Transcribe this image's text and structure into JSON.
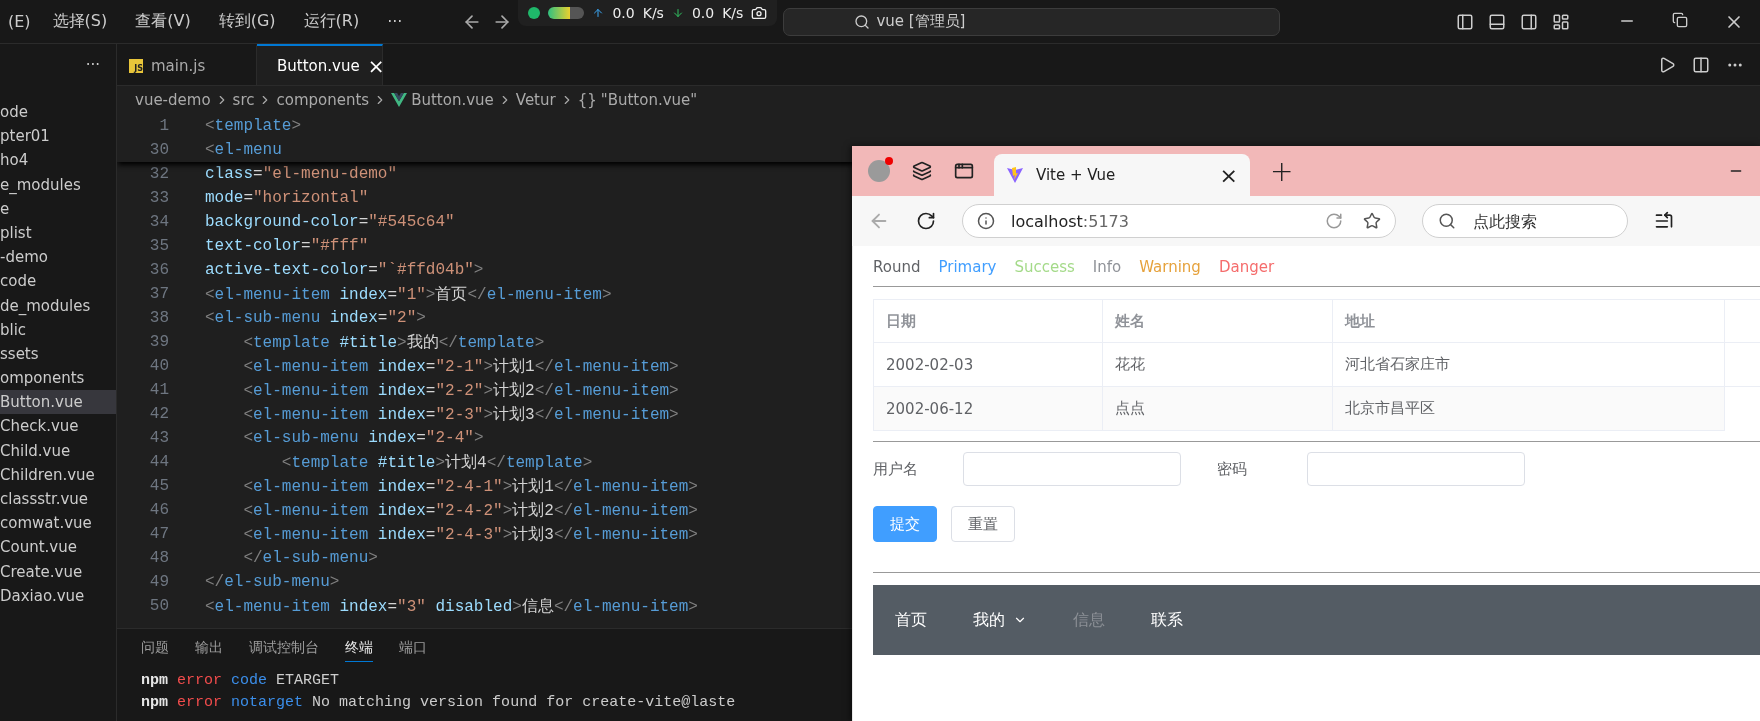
{
  "menu_bar": [
    "(E)",
    "选择(S)",
    "查看(V)",
    "转到(G)",
    "运行(R)",
    "···"
  ],
  "network_widget": {
    "up": "0.0",
    "up_unit": "K/s",
    "down": "0.0",
    "down_unit": "K/s"
  },
  "command_center": {
    "text": "vue [管理员]"
  },
  "sidebar": {
    "more": "···",
    "items": [
      {
        "label": "ode",
        "selected": false
      },
      {
        "label": "pter01",
        "selected": false
      },
      {
        "label": "ho4",
        "selected": false
      },
      {
        "label": "e_modules",
        "selected": false
      },
      {
        "label": "e",
        "selected": false
      },
      {
        "label": "plist",
        "selected": false
      },
      {
        "label": "-demo",
        "selected": false
      },
      {
        "label": "code",
        "selected": false
      },
      {
        "label": "de_modules",
        "selected": false
      },
      {
        "label": "blic",
        "selected": false
      },
      {
        "label": "ssets",
        "selected": false
      },
      {
        "label": "omponents",
        "selected": false
      },
      {
        "label": "Button.vue",
        "selected": true
      },
      {
        "label": "Check.vue",
        "selected": false
      },
      {
        "label": "Child.vue",
        "selected": false
      },
      {
        "label": "Children.vue",
        "selected": false
      },
      {
        "label": "classstr.vue",
        "selected": false
      },
      {
        "label": "comwat.vue",
        "selected": false
      },
      {
        "label": "Count.vue",
        "selected": false
      },
      {
        "label": "Create.vue",
        "selected": false
      },
      {
        "label": "Daxiao.vue",
        "selected": false
      }
    ]
  },
  "editor_tabs": [
    {
      "label": "main.js",
      "kind": "js",
      "badge": "JS",
      "selected": false
    },
    {
      "label": "Button.vue",
      "kind": "vue",
      "selected": true,
      "close": "×"
    }
  ],
  "breadcrumb": [
    {
      "label": "vue-demo",
      "kind": "text"
    },
    {
      "label": "src",
      "kind": "text"
    },
    {
      "label": "components",
      "kind": "text"
    },
    {
      "label": "Button.vue",
      "kind": "vue"
    },
    {
      "label": "Vetur",
      "kind": "text"
    },
    {
      "label": "\"Button.vue\"",
      "kind": "braces",
      "icon": "{}"
    }
  ],
  "sticky_lines": [
    {
      "n": "1",
      "tokens": [
        {
          "kind": "p",
          "text": "<"
        },
        {
          "kind": "tag",
          "text": "template"
        },
        {
          "kind": "p",
          "text": ">"
        }
      ]
    },
    {
      "n": "30",
      "tokens": [
        {
          "kind": "p",
          "text": "<"
        },
        {
          "kind": "tag",
          "text": "el-menu"
        }
      ]
    }
  ],
  "code_lines": [
    {
      "n": "32",
      "tokens": [
        {
          "kind": "attr",
          "text": "class"
        },
        {
          "kind": "text",
          "text": "="
        },
        {
          "kind": "str",
          "text": "\"el-menu-demo\""
        }
      ]
    },
    {
      "n": "33",
      "tokens": [
        {
          "kind": "attr",
          "text": "mode"
        },
        {
          "kind": "text",
          "text": "="
        },
        {
          "kind": "str",
          "text": "\"horizontal\""
        }
      ]
    },
    {
      "n": "34",
      "tokens": [
        {
          "kind": "attr",
          "text": "background-color"
        },
        {
          "kind": "text",
          "text": "="
        },
        {
          "kind": "str",
          "text": "\"#545c64\""
        }
      ]
    },
    {
      "n": "35",
      "tokens": [
        {
          "kind": "attr",
          "text": "text-color"
        },
        {
          "kind": "text",
          "text": "="
        },
        {
          "kind": "str",
          "text": "\"#fff\""
        }
      ]
    },
    {
      "n": "36",
      "tokens": [
        {
          "kind": "attr",
          "text": "active-text-color"
        },
        {
          "kind": "text",
          "text": "="
        },
        {
          "kind": "str",
          "text": "\"`#ffd04b\""
        },
        {
          "kind": "p",
          "text": ">"
        }
      ]
    },
    {
      "n": "37",
      "tokens": [
        {
          "kind": "p",
          "text": "<"
        },
        {
          "kind": "tag",
          "text": "el-menu-item"
        },
        {
          "kind": "attr",
          "text": " index"
        },
        {
          "kind": "text",
          "text": "="
        },
        {
          "kind": "str",
          "text": "\"1\""
        },
        {
          "kind": "p",
          "text": ">"
        },
        {
          "kind": "text",
          "text": "首页"
        },
        {
          "kind": "p",
          "text": "</"
        },
        {
          "kind": "tag",
          "text": "el-menu-item"
        },
        {
          "kind": "p",
          "text": ">"
        }
      ]
    },
    {
      "n": "38",
      "tokens": [
        {
          "kind": "p",
          "text": "<"
        },
        {
          "kind": "tag",
          "text": "el-sub-menu"
        },
        {
          "kind": "attr",
          "text": " index"
        },
        {
          "kind": "text",
          "text": "="
        },
        {
          "kind": "str",
          "text": "\"2\""
        },
        {
          "kind": "p",
          "text": ">"
        }
      ]
    },
    {
      "n": "39",
      "tokens": [
        {
          "kind": "p",
          "text": "    <"
        },
        {
          "kind": "tag",
          "text": "template"
        },
        {
          "kind": "attr",
          "text": " #title"
        },
        {
          "kind": "p",
          "text": ">"
        },
        {
          "kind": "text",
          "text": "我的"
        },
        {
          "kind": "p",
          "text": "</"
        },
        {
          "kind": "tag",
          "text": "template"
        },
        {
          "kind": "p",
          "text": ">"
        }
      ]
    },
    {
      "n": "40",
      "tokens": [
        {
          "kind": "p",
          "text": "    <"
        },
        {
          "kind": "tag",
          "text": "el-menu-item"
        },
        {
          "kind": "attr",
          "text": " index"
        },
        {
          "kind": "text",
          "text": "="
        },
        {
          "kind": "str",
          "text": "\"2-1\""
        },
        {
          "kind": "p",
          "text": ">"
        },
        {
          "kind": "text",
          "text": "计划1"
        },
        {
          "kind": "p",
          "text": "</"
        },
        {
          "kind": "tag",
          "text": "el-menu-item"
        },
        {
          "kind": "p",
          "text": ">"
        }
      ]
    },
    {
      "n": "41",
      "tokens": [
        {
          "kind": "p",
          "text": "    <"
        },
        {
          "kind": "tag",
          "text": "el-menu-item"
        },
        {
          "kind": "attr",
          "text": " index"
        },
        {
          "kind": "text",
          "text": "="
        },
        {
          "kind": "str",
          "text": "\"2-2\""
        },
        {
          "kind": "p",
          "text": ">"
        },
        {
          "kind": "text",
          "text": "计划2"
        },
        {
          "kind": "p",
          "text": "</"
        },
        {
          "kind": "tag",
          "text": "el-menu-item"
        },
        {
          "kind": "p",
          "text": ">"
        }
      ]
    },
    {
      "n": "42",
      "tokens": [
        {
          "kind": "p",
          "text": "    <"
        },
        {
          "kind": "tag",
          "text": "el-menu-item"
        },
        {
          "kind": "attr",
          "text": " index"
        },
        {
          "kind": "text",
          "text": "="
        },
        {
          "kind": "str",
          "text": "\"2-3\""
        },
        {
          "kind": "p",
          "text": ">"
        },
        {
          "kind": "text",
          "text": "计划3"
        },
        {
          "kind": "p",
          "text": "</"
        },
        {
          "kind": "tag",
          "text": "el-menu-item"
        },
        {
          "kind": "p",
          "text": ">"
        }
      ]
    },
    {
      "n": "43",
      "tokens": [
        {
          "kind": "p",
          "text": "    <"
        },
        {
          "kind": "tag",
          "text": "el-sub-menu"
        },
        {
          "kind": "attr",
          "text": " index"
        },
        {
          "kind": "text",
          "text": "="
        },
        {
          "kind": "str",
          "text": "\"2-4\""
        },
        {
          "kind": "p",
          "text": ">"
        }
      ]
    },
    {
      "n": "44",
      "tokens": [
        {
          "kind": "p",
          "text": "        <"
        },
        {
          "kind": "tag",
          "text": "template"
        },
        {
          "kind": "attr",
          "text": " #title"
        },
        {
          "kind": "p",
          "text": ">"
        },
        {
          "kind": "text",
          "text": "计划4"
        },
        {
          "kind": "p",
          "text": "</"
        },
        {
          "kind": "tag",
          "text": "template"
        },
        {
          "kind": "p",
          "text": ">"
        }
      ]
    },
    {
      "n": "45",
      "tokens": [
        {
          "kind": "p",
          "text": "    <"
        },
        {
          "kind": "tag",
          "text": "el-menu-item"
        },
        {
          "kind": "attr",
          "text": " index"
        },
        {
          "kind": "text",
          "text": "="
        },
        {
          "kind": "str",
          "text": "\"2-4-1\""
        },
        {
          "kind": "p",
          "text": ">"
        },
        {
          "kind": "text",
          "text": "计划1"
        },
        {
          "kind": "p",
          "text": "</"
        },
        {
          "kind": "tag",
          "text": "el-menu-item"
        },
        {
          "kind": "p",
          "text": ">"
        }
      ]
    },
    {
      "n": "46",
      "tokens": [
        {
          "kind": "p",
          "text": "    <"
        },
        {
          "kind": "tag",
          "text": "el-menu-item"
        },
        {
          "kind": "attr",
          "text": " index"
        },
        {
          "kind": "text",
          "text": "="
        },
        {
          "kind": "str",
          "text": "\"2-4-2\""
        },
        {
          "kind": "p",
          "text": ">"
        },
        {
          "kind": "text",
          "text": "计划2"
        },
        {
          "kind": "p",
          "text": "</"
        },
        {
          "kind": "tag",
          "text": "el-menu-item"
        },
        {
          "kind": "p",
          "text": ">"
        }
      ]
    },
    {
      "n": "47",
      "tokens": [
        {
          "kind": "p",
          "text": "    <"
        },
        {
          "kind": "tag",
          "text": "el-menu-item"
        },
        {
          "kind": "attr",
          "text": " index"
        },
        {
          "kind": "text",
          "text": "="
        },
        {
          "kind": "str",
          "text": "\"2-4-3\""
        },
        {
          "kind": "p",
          "text": ">"
        },
        {
          "kind": "text",
          "text": "计划3"
        },
        {
          "kind": "p",
          "text": "</"
        },
        {
          "kind": "tag",
          "text": "el-menu-item"
        },
        {
          "kind": "p",
          "text": ">"
        }
      ]
    },
    {
      "n": "48",
      "tokens": [
        {
          "kind": "p",
          "text": "    </"
        },
        {
          "kind": "tag",
          "text": "el-sub-menu"
        },
        {
          "kind": "p",
          "text": ">"
        }
      ]
    },
    {
      "n": "49",
      "tokens": [
        {
          "kind": "p",
          "text": "</"
        },
        {
          "kind": "tag",
          "text": "el-sub-menu"
        },
        {
          "kind": "p",
          "text": ">"
        }
      ]
    },
    {
      "n": "50",
      "tokens": [
        {
          "kind": "p",
          "text": "<"
        },
        {
          "kind": "tag",
          "text": "el-menu-item"
        },
        {
          "kind": "attr",
          "text": " index"
        },
        {
          "kind": "text",
          "text": "="
        },
        {
          "kind": "str",
          "text": "\"3\""
        },
        {
          "kind": "attr",
          "text": " disabled"
        },
        {
          "kind": "p",
          "text": ">"
        },
        {
          "kind": "text",
          "text": "信息"
        },
        {
          "kind": "p",
          "text": "</"
        },
        {
          "kind": "tag",
          "text": "el-menu-item"
        },
        {
          "kind": "p",
          "text": ">"
        }
      ]
    }
  ],
  "panel_tabs": [
    {
      "label": "问题",
      "selected": false
    },
    {
      "label": "输出",
      "selected": false
    },
    {
      "label": "调试控制台",
      "selected": false
    },
    {
      "label": "终端",
      "selected": true
    },
    {
      "label": "端口",
      "selected": false
    }
  ],
  "terminal_lines": [
    {
      "tokens": [
        {
          "kind": "npm",
          "text": "npm"
        },
        {
          "kind": "err",
          "text": "error"
        },
        {
          "kind": "key",
          "text": "code"
        },
        {
          "kind": "text",
          "text": "ETARGET"
        }
      ]
    },
    {
      "tokens": [
        {
          "kind": "npm",
          "text": "npm"
        },
        {
          "kind": "err",
          "text": "error"
        },
        {
          "kind": "key",
          "text": "notarget"
        },
        {
          "kind": "text",
          "text": "No matching version found for create-vite@laste"
        }
      ]
    }
  ],
  "browser": {
    "tab": {
      "title": "Vite + Vue",
      "close": "×"
    },
    "new_tab": "+",
    "address": {
      "host": "localhost",
      "port": ":5173"
    },
    "search": {
      "placeholder": "点此搜索"
    },
    "page": {
      "buttons": [
        {
          "label": "Round",
          "color": "#606266"
        },
        {
          "label": "Primary",
          "color": "#409eff"
        },
        {
          "label": "Success",
          "color": "#a4da89"
        },
        {
          "label": "Info",
          "color": "#909399"
        },
        {
          "label": "Warning",
          "color": "#e6a23c"
        },
        {
          "label": "Danger",
          "color": "#f56c6c"
        }
      ],
      "table": {
        "columns": [
          "日期",
          "姓名",
          "地址"
        ],
        "rows": [
          [
            "2002-02-03",
            "花花",
            "河北省石家庄市"
          ],
          [
            "2002-06-12",
            "点点",
            "北京市昌平区"
          ]
        ]
      },
      "form": {
        "fields": [
          {
            "label": "用户名"
          },
          {
            "label": "密码"
          }
        ],
        "buttons": [
          {
            "label": "提交",
            "kind": "primary"
          },
          {
            "label": "重置",
            "kind": "default"
          }
        ]
      },
      "menu": [
        {
          "label": "首页",
          "kind": "item",
          "disabled": false
        },
        {
          "label": "我的",
          "kind": "submenu",
          "disabled": false
        },
        {
          "label": "信息",
          "kind": "item",
          "disabled": true
        },
        {
          "label": "联系",
          "kind": "item",
          "disabled": false
        }
      ]
    }
  }
}
